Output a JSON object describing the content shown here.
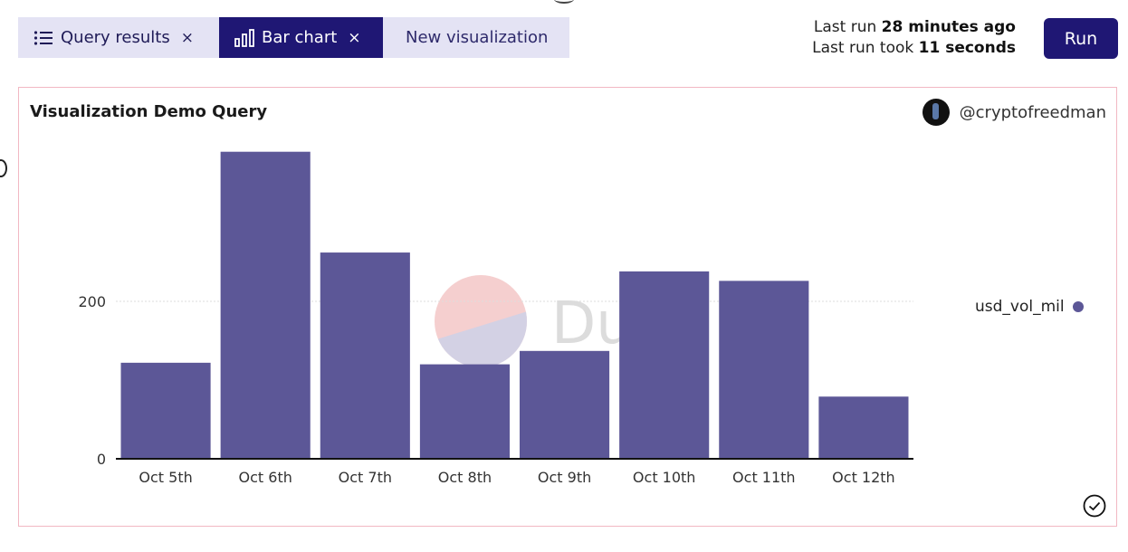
{
  "tabs": [
    {
      "label": "Query results",
      "icon": "list-icon",
      "closable": true,
      "active": false
    },
    {
      "label": "Bar chart",
      "icon": "bar-chart-icon",
      "closable": true,
      "active": true
    },
    {
      "label": "New visualization",
      "closable": false,
      "active": false
    }
  ],
  "run_info": {
    "line1_prefix": "Last run",
    "line1_value": "28 minutes ago",
    "line2_prefix": "Last run took",
    "line2_value": "11 seconds"
  },
  "run_button": "Run",
  "close_glyph": "×",
  "panel": {
    "title": "Visualization Demo Query",
    "author": "@cryptofreedman",
    "watermark": "Dune"
  },
  "colors": {
    "accent": "#1f1774",
    "bar": "#5c5797",
    "tab_bg": "#e4e3f4",
    "panel_border": "#f2b8c3"
  },
  "chart_data": {
    "type": "bar",
    "categories": [
      "Oct 5th",
      "Oct 6th",
      "Oct 7th",
      "Oct 8th",
      "Oct 9th",
      "Oct 10th",
      "Oct 11th",
      "Oct 12th"
    ],
    "series": [
      {
        "name": "usd_vol_mil",
        "values": [
          122,
          390,
          262,
          120,
          137,
          238,
          226,
          79
        ]
      }
    ],
    "yticks": [
      0,
      200
    ],
    "ylim": [
      0,
      400
    ],
    "grid": true,
    "legend": "right"
  }
}
